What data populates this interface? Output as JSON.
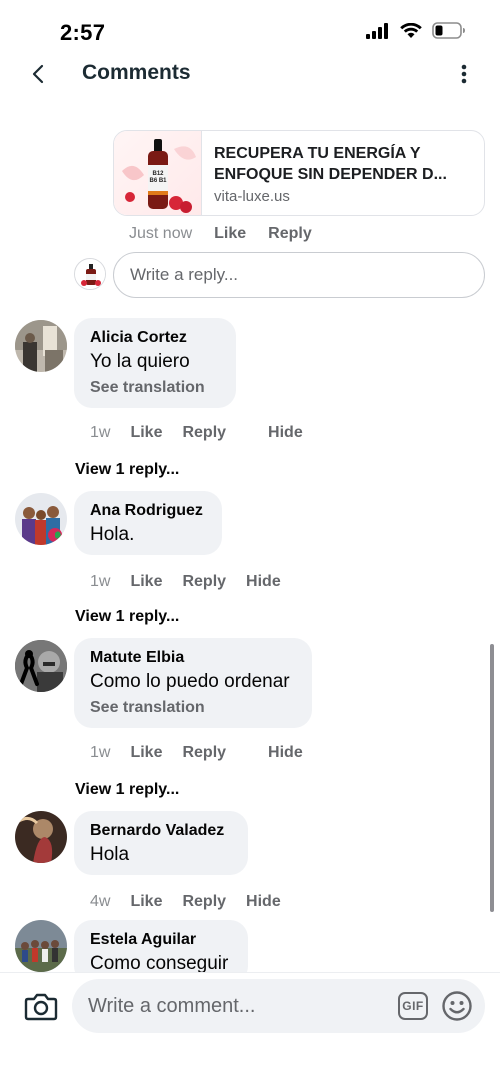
{
  "status_bar": {
    "time": "2:57"
  },
  "header": {
    "title": "Comments"
  },
  "link_preview": {
    "title": "RECUPERA TU ENERGÍA Y ENFOQUE SIN DEPENDER D...",
    "domain": "vita-luxe.us",
    "product_label": "B12 B6 B1"
  },
  "post_actions": {
    "time": "Just now",
    "like": "Like",
    "reply": "Reply"
  },
  "reply_box": {
    "placeholder": "Write a reply..."
  },
  "comments": [
    {
      "name": "Alicia Cortez",
      "text": "Yo la quiero",
      "translation": "See translation",
      "time": "1w",
      "like": "Like",
      "reply": "Reply",
      "hide": "Hide",
      "view_replies": "View 1 reply..."
    },
    {
      "name": "Ana Rodriguez",
      "text": "Hola.",
      "time": "1w",
      "like": "Like",
      "reply": "Reply",
      "hide": "Hide",
      "view_replies": "View 1 reply..."
    },
    {
      "name": "Matute Elbia",
      "text": "Como lo puedo ordenar",
      "translation": "See translation",
      "time": "1w",
      "like": "Like",
      "reply": "Reply",
      "hide": "Hide",
      "view_replies": "View 1 reply..."
    },
    {
      "name": "Bernardo Valadez",
      "text": "Hola",
      "time": "4w",
      "like": "Like",
      "reply": "Reply",
      "hide": "Hide"
    },
    {
      "name": "Estela Aguilar",
      "text": "Como conseguir"
    }
  ],
  "composer": {
    "placeholder": "Write a comment...",
    "gif_label": "GIF"
  },
  "icons": {
    "back": "chevron-left-icon",
    "more": "vertical-dots-icon",
    "camera": "camera-icon",
    "gif": "gif-icon",
    "emoji": "smiley-icon"
  },
  "colors": {
    "secondary_text": "#65676b",
    "bubble": "#f0f2f5",
    "title": "#1c2b33"
  }
}
